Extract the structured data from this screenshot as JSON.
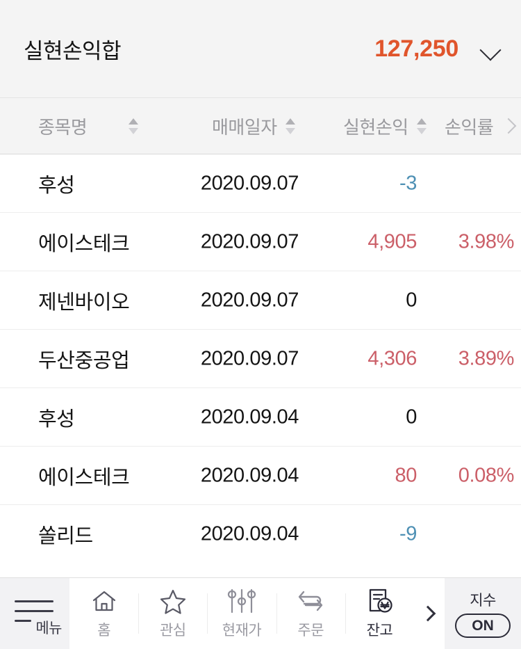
{
  "summary": {
    "label": "실현손익합",
    "value": "127,250",
    "expand_icon": "chevron-down-icon",
    "value_color": "#e0552c"
  },
  "table": {
    "columns": [
      {
        "label": "종목명",
        "sortable": true
      },
      {
        "label": "매매일자",
        "sortable": true
      },
      {
        "label": "실현손익",
        "sortable": true
      },
      {
        "label": "손익률",
        "sortable": false
      }
    ],
    "more_icon": "chevron-right-icon",
    "rows": [
      {
        "name": "후성",
        "date": "2020.09.07",
        "pl": "-3",
        "pl_sign": "neg",
        "rate": ""
      },
      {
        "name": "에이스테크",
        "date": "2020.09.07",
        "pl": "4,905",
        "pl_sign": "pos",
        "rate": "3.98%"
      },
      {
        "name": "제넨바이오",
        "date": "2020.09.07",
        "pl": "0",
        "pl_sign": "zero",
        "rate": ""
      },
      {
        "name": "두산중공업",
        "date": "2020.09.07",
        "pl": "4,306",
        "pl_sign": "pos",
        "rate": "3.89%"
      },
      {
        "name": "후성",
        "date": "2020.09.04",
        "pl": "0",
        "pl_sign": "zero",
        "rate": ""
      },
      {
        "name": "에이스테크",
        "date": "2020.09.04",
        "pl": "80",
        "pl_sign": "pos",
        "rate": "0.08%"
      },
      {
        "name": "쏠리드",
        "date": "2020.09.04",
        "pl": "-9",
        "pl_sign": "neg",
        "rate": ""
      }
    ],
    "colors": {
      "positive": "#cb5f68",
      "negative": "#4e90b4",
      "zero": "#141414"
    }
  },
  "bottom_nav": {
    "menu": {
      "label": "메뉴",
      "icon": "hamburger-icon"
    },
    "items": [
      {
        "label": "홈",
        "icon": "home-icon",
        "active": false
      },
      {
        "label": "관심",
        "icon": "star-icon",
        "active": false
      },
      {
        "label": "현재가",
        "icon": "candlestick-icon",
        "active": false
      },
      {
        "label": "주문",
        "icon": "exchange-icon",
        "active": false
      },
      {
        "label": "잔고",
        "icon": "document-won-icon",
        "active": true
      }
    ],
    "more_icon": "chevron-right-icon",
    "toggle": {
      "label": "지수",
      "state": "ON"
    }
  }
}
